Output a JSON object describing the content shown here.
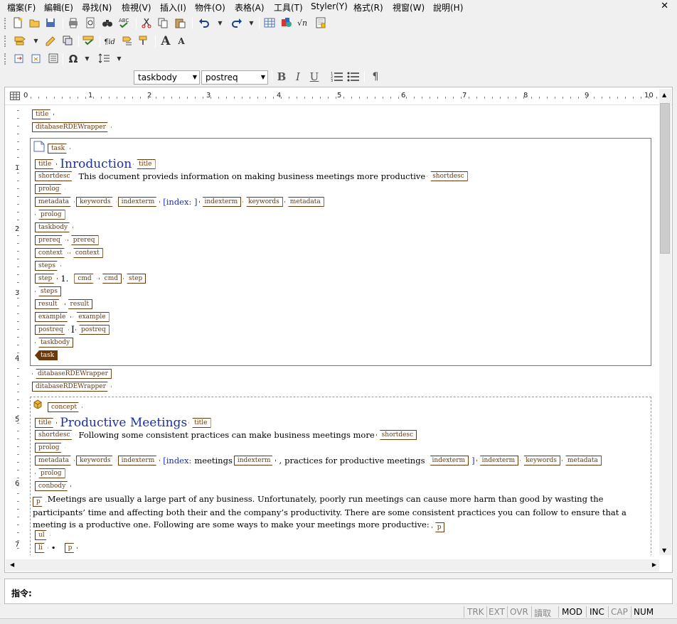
{
  "menu": [
    "檔案(F)",
    "編輯(E)",
    "尋找(N)",
    "檢視(V)",
    "插入(I)",
    "物件(O)",
    "表格(A)",
    "工具(T)",
    "Styler(Y)",
    "格式(R)",
    "視窗(W)",
    "說明(H)"
  ],
  "close_glyph": "✕",
  "toolbar3_glyphs": {
    "omega": "Ω"
  },
  "formatbar": {
    "element_combo": "taskbody",
    "style_combo": "postreq",
    "bold": "B",
    "italic": "I",
    "underline": "U",
    "pilcrow": "¶",
    "font_up": "A",
    "font_down": "A"
  },
  "ruler_numbers": [
    "0",
    "1",
    "2",
    "3",
    "4",
    "5",
    "6",
    "7",
    "8",
    "9",
    "10"
  ],
  "vruler_numbers": [
    "1",
    "2",
    "3",
    "4",
    "5",
    "6",
    "7"
  ],
  "doc": {
    "topic_tag": "title",
    "wrapper_tag": "ditabaseRDEWrapper",
    "task": {
      "tag": "task",
      "title_tag": "title",
      "title": "Inroduction",
      "shortdesc_tag": "shortdesc",
      "shortdesc": "This document provieds information on making business meetings more productive",
      "prolog_tag": "prolog",
      "metadata_tag": "metadata",
      "keywords_tag": "keywords",
      "indexterm_tag": "indexterm",
      "index_text": "[index: ]",
      "taskbody_tag": "taskbody",
      "prereq_tag": "prereq",
      "context_tag": "context",
      "steps_tag": "steps",
      "step_tag": "step",
      "step_num": "1.",
      "cmd_tag": "cmd",
      "result_tag": "result",
      "example_tag": "example",
      "postreq_tag": "postreq"
    },
    "concept": {
      "tag": "concept",
      "title_tag": "title",
      "title": "Productive Meetings",
      "shortdesc_tag": "shortdesc",
      "shortdesc": "Following some consistent practices can make business meetings more",
      "prolog_tag": "prolog",
      "metadata_tag": "metadata",
      "keywords_tag": "keywords",
      "indexterm_tag": "indexterm",
      "index_open": "[index:",
      "index_term1": "meetings",
      "index_sep": ",",
      "index_term2": "practices for productive meetings",
      "index_close": "]",
      "conbody_tag": "conbody",
      "p_tag": "p",
      "paragraph": "Meetings are usually a large part of any business. Unfortunately, poorly run meetings can cause more harm than good by wasting the participants’ time and affecting both their and the company’s productivity. There are some consistent practices you can follow to ensure that a meeting is a productive one. Following are some ways to make your meetings more productive:",
      "ul_tag": "ul",
      "li_tag": "li",
      "bullet": "•"
    }
  },
  "command": {
    "label": "指令:"
  },
  "status": [
    "TRK",
    "EXT",
    "OVR",
    "讀取",
    "MOD",
    "INC",
    "CAP",
    "NUM"
  ]
}
